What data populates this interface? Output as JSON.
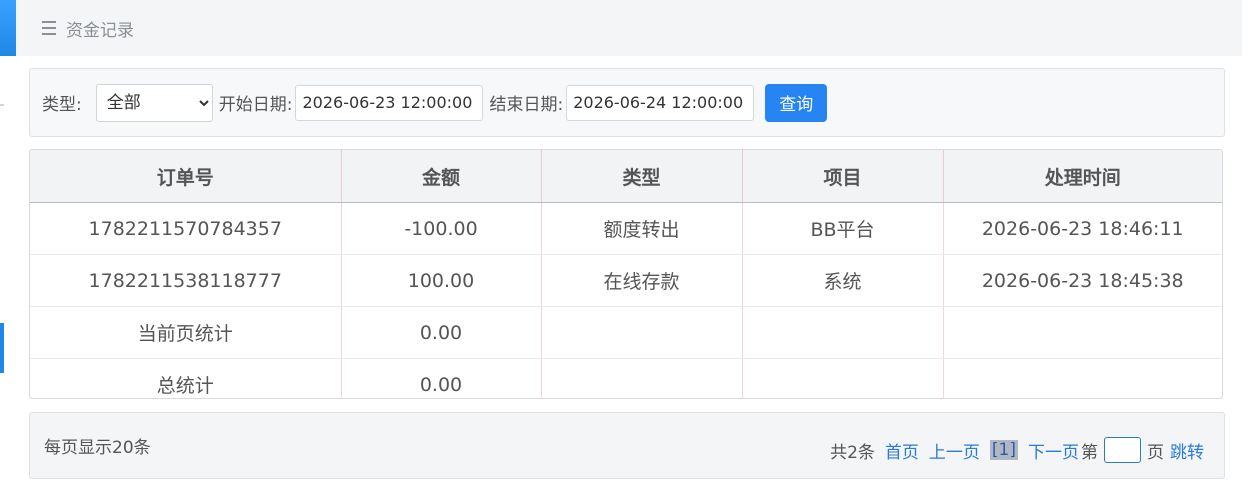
{
  "header": {
    "title": "资金记录"
  },
  "filter": {
    "type_label": "类型:",
    "type_value": "全部",
    "start_label": "开始日期:",
    "start_value": "2026-06-23 12:00:00",
    "end_label": "结束日期:",
    "end_value": "2026-06-24 12:00:00",
    "query_label": "查询"
  },
  "table": {
    "columns": [
      "订单号",
      "金额",
      "类型",
      "项目",
      "处理时间"
    ],
    "rows": [
      [
        "1782211570784357",
        "-100.00",
        "额度转出",
        "BB平台",
        "2026-06-23 18:46:11"
      ],
      [
        "1782211538118777",
        "100.00",
        "在线存款",
        "系统",
        "2026-06-23 18:45:38"
      ],
      [
        "当前页统计",
        "0.00",
        "",
        "",
        ""
      ],
      [
        "总统计",
        "0.00",
        "",
        "",
        ""
      ]
    ]
  },
  "pager": {
    "per_page": "每页显示20条",
    "total": "共2条",
    "first": "首页",
    "prev": "上一页",
    "current": "[1]",
    "next": "下一页",
    "page_prefix": "第",
    "page_suffix": "页",
    "jump": "跳转"
  },
  "colors": {
    "accent": "#2684f3",
    "header_bg": "#f4f5f7",
    "link": "#2a7ad8"
  }
}
